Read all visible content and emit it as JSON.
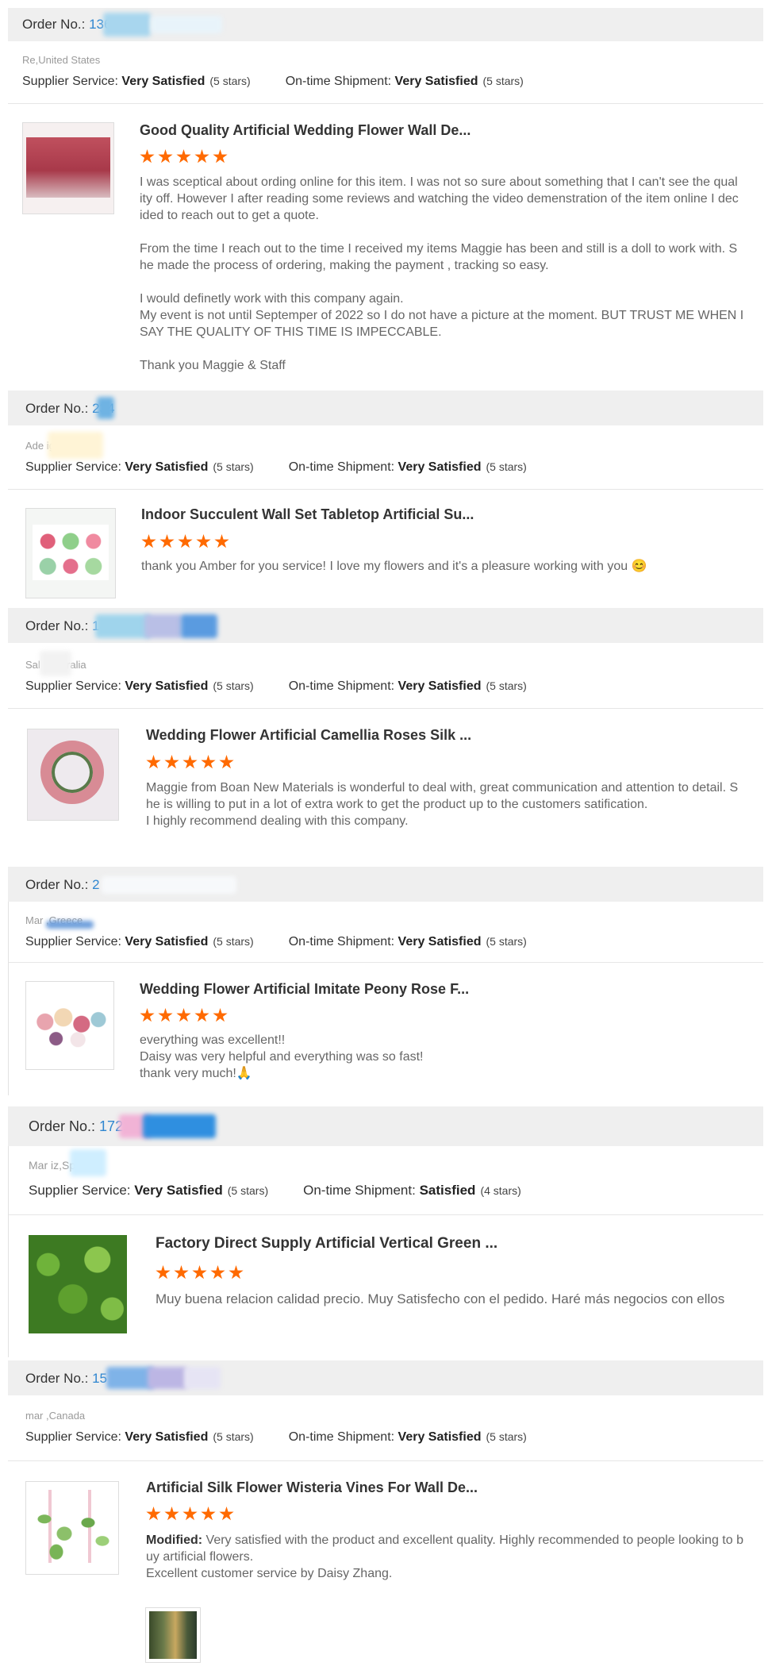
{
  "reviews": [
    {
      "order_label": "Order No.:",
      "order_num": "136",
      "location": "Re,United States",
      "supplier_label": "Supplier Service:",
      "supplier_value": "Very Satisfied",
      "supplier_stars": "(5 stars)",
      "shipment_label": "On-time Shipment:",
      "shipment_value": "Very Satisfied",
      "shipment_stars": "(5 stars)",
      "product_title": "Good Quality Artificial Wedding Flower Wall De...",
      "rating": 5,
      "text": "I was sceptical about ording online for this item. I was not so sure about something that I can't see the qual\nity off. However I after reading some reviews and watching the video demenstration of the item online I dec\nided to reach out to get a quote.\n\nFrom the time I reach out to the time I received my items Maggie has been and still is a doll to work with. S\nhe made the process of ordering, making the payment , tracking so easy.\n\nI would definetly work with this company again.\nMy event is not until Septemper of 2022 so I do not have a picture at the moment. BUT TRUST ME WHEN I\nSAY THE QUALITY OF THIS TIME IS IMPECCABLE.\n\nThank you Maggie & Staff"
    },
    {
      "order_label": "Order No.:",
      "order_num": "234",
      "location": "Ade igeria",
      "supplier_label": "Supplier Service:",
      "supplier_value": "Very Satisfied",
      "supplier_stars": "(5 stars)",
      "shipment_label": "On-time Shipment:",
      "shipment_value": "Very Satisfied",
      "shipment_stars": "(5 stars)",
      "product_title": "Indoor Succulent Wall Set Tabletop Artificial Su...",
      "rating": 5,
      "text": "thank you Amber for you service! I love my flowers and it's a pleasure working with you 😊"
    },
    {
      "order_label": "Order No.:",
      "order_num": "14",
      "location": "Sal ,Australia",
      "supplier_label": "Supplier Service:",
      "supplier_value": "Very Satisfied",
      "supplier_stars": "(5 stars)",
      "shipment_label": "On-time Shipment:",
      "shipment_value": "Very Satisfied",
      "shipment_stars": "(5 stars)",
      "product_title": "Wedding Flower Artificial Camellia Roses Silk ...",
      "rating": 5,
      "text": "Maggie from Boan New Materials is wonderful to deal with, great communication and attention to detail.  S\nhe is willing to put in a lot of extra work to get the product up to the customers satification.\nI highly recommend dealing with this company."
    },
    {
      "order_label": "Order No.:",
      "order_num": "2",
      "location": "Mar ,Greece",
      "supplier_label": "Supplier Service:",
      "supplier_value": "Very Satisfied",
      "supplier_stars": "(5 stars)",
      "shipment_label": "On-time Shipment:",
      "shipment_value": "Very Satisfied",
      "shipment_stars": "(5 stars)",
      "product_title": "Wedding Flower Artificial Imitate Peony Rose F...",
      "rating": 5,
      "text": "everything was excellent!!\nDaisy was very helpful and everything was so fast!\nthank very much!🙏"
    },
    {
      "order_label": "Order No.:",
      "order_num": "1722 7",
      "location": "Mar iz,Spain",
      "supplier_label": "Supplier Service:",
      "supplier_value": "Very Satisfied",
      "supplier_stars": "(5 stars)",
      "shipment_label": "On-time Shipment:",
      "shipment_value": "Satisfied",
      "shipment_stars": "(4 stars)",
      "product_title": "Factory Direct Supply Artificial Vertical Green ...",
      "rating": 5,
      "text": "Muy buena relacion calidad precio. Muy Satisfecho con el pedido. Haré más negocios con ellos"
    },
    {
      "order_label": "Order No.:",
      "order_num": "15",
      "location": "mar ,Canada",
      "supplier_label": "Supplier Service:",
      "supplier_value": "Very Satisfied",
      "supplier_stars": "(5 stars)",
      "shipment_label": "On-time Shipment:",
      "shipment_value": "Very Satisfied",
      "shipment_stars": "(5 stars)",
      "product_title": "Artificial Silk Flower Wisteria Vines For Wall De...",
      "rating": 5,
      "modified_label": "Modified:",
      "text": " Very satisfied with the product and excellent quality. Highly recommended to people looking to b\nuy artificial flowers.\nExcellent customer service by Daisy Zhang."
    }
  ]
}
